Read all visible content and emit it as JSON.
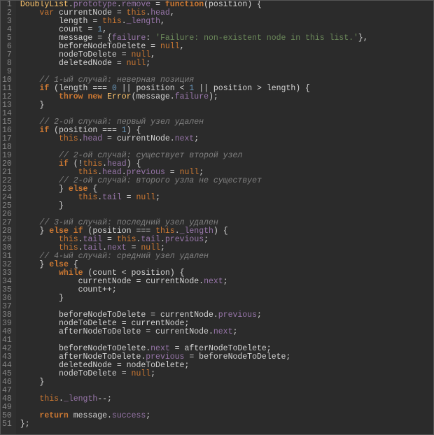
{
  "lines": [
    {
      "n": 1,
      "seg": [
        [
          "id",
          "DoublyList"
        ],
        [
          "w",
          "."
        ],
        [
          "p",
          "prototype"
        ],
        [
          "w",
          "."
        ],
        [
          "p",
          "remove"
        ],
        [
          "w",
          " = "
        ],
        [
          "k",
          "function"
        ],
        [
          "w",
          "(position) {"
        ]
      ]
    },
    {
      "n": 2,
      "seg": [
        [
          "w",
          "    "
        ],
        [
          "v",
          "var"
        ],
        [
          "w",
          " currentNode = "
        ],
        [
          "t",
          "this"
        ],
        [
          "w",
          "."
        ],
        [
          "p",
          "head"
        ],
        [
          "w",
          ","
        ]
      ]
    },
    {
      "n": 3,
      "seg": [
        [
          "w",
          "        length = "
        ],
        [
          "t",
          "this"
        ],
        [
          "w",
          "."
        ],
        [
          "p",
          "_length"
        ],
        [
          "w",
          ","
        ]
      ]
    },
    {
      "n": 4,
      "seg": [
        [
          "w",
          "        count = "
        ],
        [
          "n",
          "1"
        ],
        [
          "w",
          ","
        ]
      ]
    },
    {
      "n": 5,
      "seg": [
        [
          "w",
          "        message = {"
        ],
        [
          "p",
          "failure"
        ],
        [
          "w",
          ": "
        ],
        [
          "s",
          "'Failure: non-existent node in this list.'"
        ],
        [
          "w",
          "},"
        ]
      ]
    },
    {
      "n": 6,
      "seg": [
        [
          "w",
          "        beforeNodeToDelete = "
        ],
        [
          "nul",
          "null"
        ],
        [
          "w",
          ","
        ]
      ]
    },
    {
      "n": 7,
      "seg": [
        [
          "w",
          "        nodeToDelete = "
        ],
        [
          "nul",
          "null"
        ],
        [
          "w",
          ","
        ]
      ]
    },
    {
      "n": 8,
      "seg": [
        [
          "w",
          "        deletedNode = "
        ],
        [
          "nul",
          "null"
        ],
        [
          "w",
          ";"
        ]
      ]
    },
    {
      "n": 9,
      "seg": [
        [
          "w",
          " "
        ]
      ]
    },
    {
      "n": 10,
      "seg": [
        [
          "w",
          "    "
        ],
        [
          "c",
          "// 1-ый случай: неверная позиция"
        ]
      ]
    },
    {
      "n": 11,
      "seg": [
        [
          "w",
          "    "
        ],
        [
          "k",
          "if"
        ],
        [
          "w",
          " (length === "
        ],
        [
          "n",
          "0"
        ],
        [
          "w",
          " || position < "
        ],
        [
          "n",
          "1"
        ],
        [
          "w",
          " || position > length) {"
        ]
      ]
    },
    {
      "n": 12,
      "seg": [
        [
          "w",
          "        "
        ],
        [
          "k",
          "throw new"
        ],
        [
          "w",
          " "
        ],
        [
          "err",
          "Error"
        ],
        [
          "w",
          "(message."
        ],
        [
          "p",
          "failure"
        ],
        [
          "w",
          ");"
        ]
      ]
    },
    {
      "n": 13,
      "seg": [
        [
          "w",
          "    }"
        ]
      ]
    },
    {
      "n": 14,
      "seg": [
        [
          "w",
          " "
        ]
      ]
    },
    {
      "n": 15,
      "seg": [
        [
          "w",
          "    "
        ],
        [
          "c",
          "// 2-ой случай: первый узел удален"
        ]
      ]
    },
    {
      "n": 16,
      "seg": [
        [
          "w",
          "    "
        ],
        [
          "k",
          "if"
        ],
        [
          "w",
          " (position === "
        ],
        [
          "n",
          "1"
        ],
        [
          "w",
          ") {"
        ]
      ]
    },
    {
      "n": 17,
      "seg": [
        [
          "w",
          "        "
        ],
        [
          "t",
          "this"
        ],
        [
          "w",
          "."
        ],
        [
          "p",
          "head"
        ],
        [
          "w",
          " = currentNode."
        ],
        [
          "p",
          "next"
        ],
        [
          "w",
          ";"
        ]
      ]
    },
    {
      "n": 18,
      "seg": [
        [
          "w",
          " "
        ]
      ]
    },
    {
      "n": 19,
      "seg": [
        [
          "w",
          "        "
        ],
        [
          "c",
          "// 2-ой случай: существует второй узел"
        ]
      ]
    },
    {
      "n": 20,
      "seg": [
        [
          "w",
          "        "
        ],
        [
          "k",
          "if"
        ],
        [
          "w",
          " (!"
        ],
        [
          "t",
          "this"
        ],
        [
          "w",
          "."
        ],
        [
          "p",
          "head"
        ],
        [
          "w",
          ") {"
        ]
      ]
    },
    {
      "n": 21,
      "seg": [
        [
          "w",
          "            "
        ],
        [
          "t",
          "this"
        ],
        [
          "w",
          "."
        ],
        [
          "p",
          "head"
        ],
        [
          "w",
          "."
        ],
        [
          "p",
          "previous"
        ],
        [
          "w",
          " = "
        ],
        [
          "nul",
          "null"
        ],
        [
          "w",
          ";"
        ]
      ]
    },
    {
      "n": 22,
      "seg": [
        [
          "w",
          "        "
        ],
        [
          "c",
          "// 2-ой случай: второго узла не существует"
        ]
      ]
    },
    {
      "n": 23,
      "seg": [
        [
          "w",
          "        } "
        ],
        [
          "k",
          "else"
        ],
        [
          "w",
          " {"
        ]
      ]
    },
    {
      "n": 24,
      "seg": [
        [
          "w",
          "            "
        ],
        [
          "t",
          "this"
        ],
        [
          "w",
          "."
        ],
        [
          "p",
          "tail"
        ],
        [
          "w",
          " = "
        ],
        [
          "nul",
          "null"
        ],
        [
          "w",
          ";"
        ]
      ]
    },
    {
      "n": 25,
      "seg": [
        [
          "w",
          "        }"
        ]
      ]
    },
    {
      "n": 26,
      "seg": [
        [
          "w",
          " "
        ]
      ]
    },
    {
      "n": 27,
      "seg": [
        [
          "w",
          "    "
        ],
        [
          "c",
          "// 3-ий случай: последний узел удален"
        ]
      ]
    },
    {
      "n": 28,
      "seg": [
        [
          "w",
          "    } "
        ],
        [
          "k",
          "else if"
        ],
        [
          "w",
          " (position === "
        ],
        [
          "t",
          "this"
        ],
        [
          "w",
          "."
        ],
        [
          "p",
          "_length"
        ],
        [
          "w",
          ") {"
        ]
      ]
    },
    {
      "n": 29,
      "seg": [
        [
          "w",
          "        "
        ],
        [
          "t",
          "this"
        ],
        [
          "w",
          "."
        ],
        [
          "p",
          "tail"
        ],
        [
          "w",
          " = "
        ],
        [
          "t",
          "this"
        ],
        [
          "w",
          "."
        ],
        [
          "p",
          "tail"
        ],
        [
          "w",
          "."
        ],
        [
          "p",
          "previous"
        ],
        [
          "w",
          ";"
        ]
      ]
    },
    {
      "n": 30,
      "seg": [
        [
          "w",
          "        "
        ],
        [
          "t",
          "this"
        ],
        [
          "w",
          "."
        ],
        [
          "p",
          "tail"
        ],
        [
          "w",
          "."
        ],
        [
          "p",
          "next"
        ],
        [
          "w",
          " = "
        ],
        [
          "nul",
          "null"
        ],
        [
          "w",
          ";"
        ]
      ]
    },
    {
      "n": 31,
      "seg": [
        [
          "w",
          "    "
        ],
        [
          "c",
          "// 4-ый случай: средний узел удален"
        ]
      ]
    },
    {
      "n": 32,
      "seg": [
        [
          "w",
          "    } "
        ],
        [
          "k",
          "else"
        ],
        [
          "w",
          " {"
        ]
      ]
    },
    {
      "n": 33,
      "seg": [
        [
          "w",
          "        "
        ],
        [
          "k",
          "while"
        ],
        [
          "w",
          " (count < position) {"
        ]
      ]
    },
    {
      "n": 34,
      "seg": [
        [
          "w",
          "            currentNode = currentNode."
        ],
        [
          "p",
          "next"
        ],
        [
          "w",
          ";"
        ]
      ]
    },
    {
      "n": 35,
      "seg": [
        [
          "w",
          "            count++;"
        ]
      ]
    },
    {
      "n": 36,
      "seg": [
        [
          "w",
          "        }"
        ]
      ]
    },
    {
      "n": 37,
      "seg": [
        [
          "w",
          " "
        ]
      ]
    },
    {
      "n": 38,
      "seg": [
        [
          "w",
          "        beforeNodeToDelete = currentNode."
        ],
        [
          "p",
          "previous"
        ],
        [
          "w",
          ";"
        ]
      ]
    },
    {
      "n": 39,
      "seg": [
        [
          "w",
          "        nodeToDelete = currentNode;"
        ]
      ]
    },
    {
      "n": 40,
      "seg": [
        [
          "w",
          "        afterNodeToDelete = currentNode."
        ],
        [
          "p",
          "next"
        ],
        [
          "w",
          ";"
        ]
      ]
    },
    {
      "n": 41,
      "seg": [
        [
          "w",
          " "
        ]
      ]
    },
    {
      "n": 42,
      "seg": [
        [
          "w",
          "        beforeNodeToDelete."
        ],
        [
          "p",
          "next"
        ],
        [
          "w",
          " = afterNodeToDelete;"
        ]
      ]
    },
    {
      "n": 43,
      "seg": [
        [
          "w",
          "        afterNodeToDelete."
        ],
        [
          "p",
          "previous"
        ],
        [
          "w",
          " = beforeNodeToDelete;"
        ]
      ]
    },
    {
      "n": 44,
      "seg": [
        [
          "w",
          "        deletedNode = nodeToDelete;"
        ]
      ]
    },
    {
      "n": 45,
      "seg": [
        [
          "w",
          "        nodeToDelete = "
        ],
        [
          "nul",
          "null"
        ],
        [
          "w",
          ";"
        ]
      ]
    },
    {
      "n": 46,
      "seg": [
        [
          "w",
          "    }"
        ]
      ]
    },
    {
      "n": 47,
      "seg": [
        [
          "w",
          " "
        ]
      ]
    },
    {
      "n": 48,
      "seg": [
        [
          "w",
          "    "
        ],
        [
          "t",
          "this"
        ],
        [
          "w",
          "."
        ],
        [
          "p",
          "_length"
        ],
        [
          "w",
          "--;"
        ]
      ]
    },
    {
      "n": 49,
      "seg": [
        [
          "w",
          " "
        ]
      ]
    },
    {
      "n": 50,
      "seg": [
        [
          "w",
          "    "
        ],
        [
          "k",
          "return"
        ],
        [
          "w",
          " message."
        ],
        [
          "p",
          "success"
        ],
        [
          "w",
          ";"
        ]
      ]
    },
    {
      "n": 51,
      "seg": [
        [
          "w",
          "};"
        ]
      ]
    }
  ]
}
